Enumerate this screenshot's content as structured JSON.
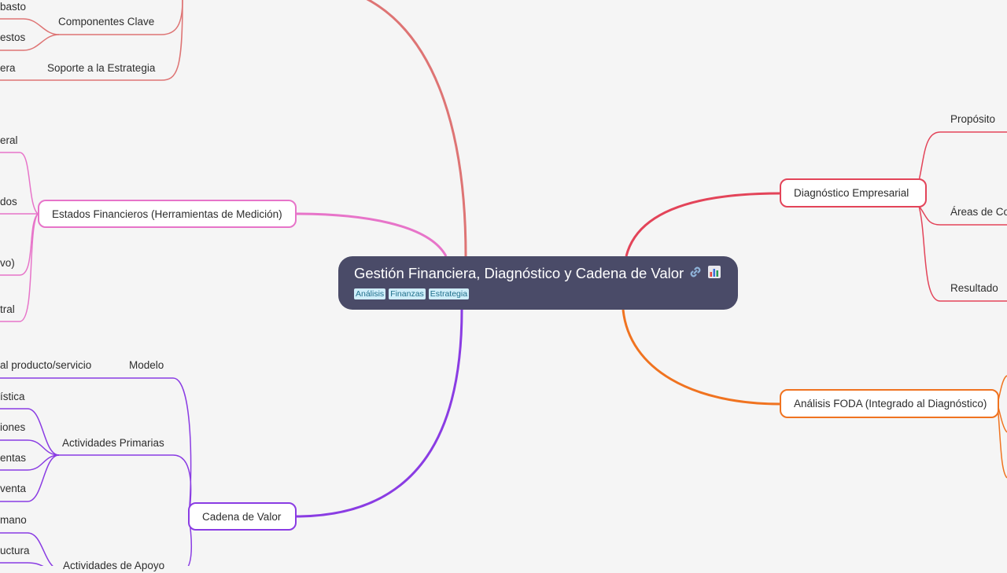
{
  "central": {
    "title": "Gestión Financiera, Diagnóstico y Cadena de Valor",
    "tags": [
      "Análisis",
      "Finanzas",
      "Estrategia"
    ],
    "icons": [
      "link-icon",
      "bar-chart-icon"
    ]
  },
  "colors": {
    "top_branch": "#de7474",
    "estados": "#e774c9",
    "cadena": "#8a3ce3",
    "diagnostico": "#e34459",
    "foda": "#f07320",
    "central_bg": "#4a4b68"
  },
  "left_top": {
    "labels": [
      "basto",
      "Componentes Clave",
      "estos",
      "era",
      "Soporte a la Estrategia"
    ]
  },
  "estados": {
    "node": "Estados Financieros (Herramientas de Medición)",
    "children": [
      "eral",
      "dos",
      "vo)",
      "tral"
    ]
  },
  "cadena": {
    "node": "Cadena de Valor",
    "modelo": "Modelo",
    "modelo_child": "al producto/servicio",
    "primarias": "Actividades Primarias",
    "primarias_children": [
      "ística",
      "iones",
      "entas",
      "venta"
    ],
    "apoyo_children": [
      "mano",
      "uctura"
    ],
    "apoyo_partial": "Actividades de Apoyo"
  },
  "diagnostico": {
    "node": "Diagnóstico Empresarial",
    "children": [
      "Propósito",
      "Áreas de Col",
      "Resultado"
    ]
  },
  "foda": {
    "node": "Análisis FODA (Integrado al Diagnóstico)"
  }
}
